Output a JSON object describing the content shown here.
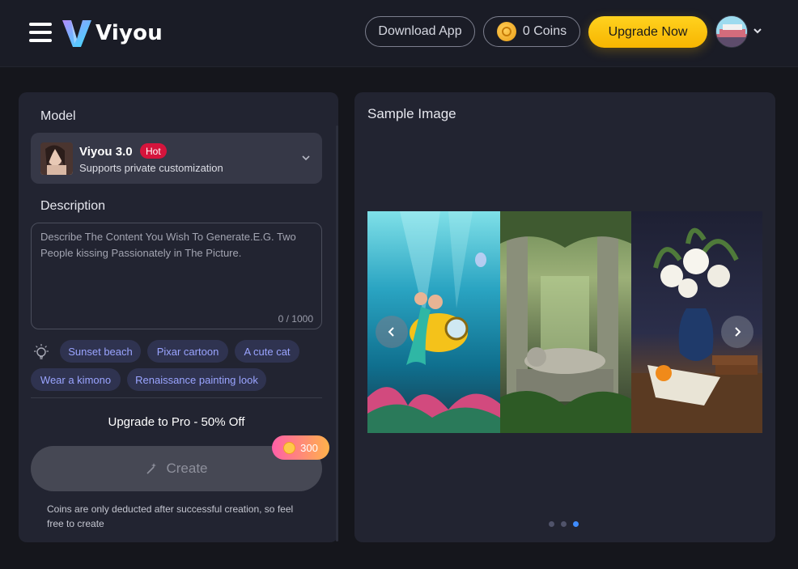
{
  "header": {
    "brand": "Viyou",
    "download_label": "Download App",
    "coins_label": "0 Coins",
    "upgrade_label": "Upgrade Now"
  },
  "sidebar_panel": {
    "model_heading": "Model",
    "model": {
      "name": "Viyou 3.0",
      "badge": "Hot",
      "subtitle": "Supports private customization"
    },
    "description_heading": "Description",
    "description": {
      "value": "",
      "placeholder": "Describe The Content You Wish To Generate.E.G. Two People kissing Passionately in The Picture.",
      "counter": "0 / 1000"
    },
    "suggestions": [
      "Sunset beach",
      "Pixar cartoon",
      "A cute cat",
      "Wear a kimono",
      "Renaissance painting look"
    ],
    "promo": "Upgrade to Pro - 50% Off",
    "create_label": "Create",
    "cost": "300",
    "note": "Coins are only deducted after successful creation, so feel free to create"
  },
  "sample": {
    "title": "Sample Image",
    "images": [
      "underwater-mermaid-submarine",
      "jungle-ruins-leopard",
      "lily-vase-still-life"
    ],
    "active_slide": 3,
    "slide_count": 3
  },
  "colors": {
    "accent_yellow": "#f7b500",
    "hot_red": "#d5143c",
    "chip_text": "#9aa4ff",
    "dot_active": "#3f8cff"
  }
}
